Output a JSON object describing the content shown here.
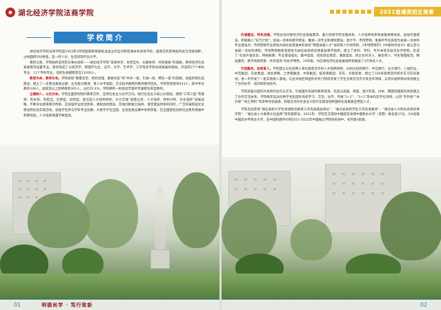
{
  "header": {
    "school_title": "湖北经济学院法商学院",
    "badge": "2021普通类招生简章"
  },
  "section": {
    "title": "学校简介"
  },
  "left_page": {
    "paragraphs": [
      {
        "highlight": "",
        "text": "湖北经济学院法商学院是2003年3月经国家教育部批准设立的全日制普通本科高等学校，座落在风景秀丽的武汉汤逊湖畔，占地面积500余亩，是一所人文、生态的现代化大学。"
      },
      {
        "highlight": "",
        "text": "建校以来，学院始终坚持走与事办高校——湖北经济学院“资源共享、优势互补、长期依存、共同发展”的道路，秉持经济社会发展需求设置专业。逐步形成了以经济学、管理学为主，法学、文学、艺术学、工学等多学科协调发展的格局。开设有27个本科专业、11个专科专业，在校生规模稳定在11000人。"
      },
      {
        "highlight": "教育为本，教师为本。",
        "text": "学院按照“数量充足、结构合理、素质优良”和“共享一批、引进一批、聘任一批”的思路，加强师资队伍建设，建立了一支政治素质过硬、业务能力精湛、育人水平高超、方法技术娴熟的教师教学团队。学校现有教师443人，其中专任教师338人，副高及以上职称教师301人，占比55.4%，学院拥有一批经验丰富的专兼职双师型教师。"
      },
      {
        "highlight": "立德树人，以生为本。",
        "text": "学院全面贯彻党的教育方针，坚持社会主义办学方向，践行社会主义核心价值观，围绕“三有三型”有理想、有本领、有担当、应用型、创新型、复合型人才培养目标，大力实施“质量立校、人才强校、特色兴校、文化强校”发展战略，不断深化教育教学改革，在加强专业综合改革、课程思政建设、实践创新能力培养、课堂建设改革的同时，广泛开展校园文化建设和社会实践活动，加强学生参与学科专业竞赛，大批学子在全国、全省各类竞赛中争获荣誉，在全国首批创新创业教育发展中积累经验，人才培养质量不断提高。"
      }
    ]
  },
  "right_page": {
    "paragraphs": [
      {
        "highlight": "内涵建设，特色发展。",
        "text": "学院主动对接经济社会发展需求，着力完善学院治理体系，人才培养体系和质量保障体系，加强内涵建设，积极融入“双万计划”，加强一流本科教学建设，推进一流专业和课程建设，会计学、市场营销、金融学专业获批为省级一流本科专业建设点；市场营销专业获批为湖北省普通本科高校“荆楚卓越人才”协同育人计划项目，《市场营销学》《中级财务会计》被认定为省级一流本科课程；市场营销教研室获批为湖北省高校优秀基层教学组织。建立了本科、专科、专升本等多层次办学结构，形成了“社会声誉优良、特色鲜明、专业建设强化、集中度高、招生就业稳定、满意度高、校企合作深入、联合育人、学生管理规范、精准服务、教学资源完善、共享度高”的办学特色，19年来，为区域经济社会发展培养和输送了3万余名人才。"
      },
      {
        "highlight": "开放融合，协同育人。",
        "text": "学院建立与社会用人单位紧密合作的人才培养机制，分别与招商银行、中信银行、光大银行、人福药业、中百集团、东星集团、湖北神鹰、土老帽集团、中商集团、拓尼奇集团、京东、华南贸易，建立了100多家稳定的校外实习实训基地，进一步开发了一批实践育人基地。与台湾地区和国外的专门院校开展了学生交换交流学习等合作项目，与贵州省黔南州等地建立了合作办学、培训等校地合作。"
      },
      {
        "highlight": "",
        "text": "学院加强与国内外高校的合作与交流，引进国外先进的教育资源，先后与美国、英国、澳大利亚、日本、韩国等国家的高校建立了合作交流关系，学院每年选派优秀学生赴国外高校学习、交流、访学，开展“2+2”、“3+1”等本科双学位项目，以及“专升硕”“本升硕”“硕士预科”等多种深造通道，积极主动为社会主义现代化建设培养国际化高素质应用型人才。"
      },
      {
        "highlight": "",
        "text": "学院先后获得“湖北高校大学生思想政治教育工作先进基层单位”、“湖北省高校学生工作先进集体”、“湖北省十大民办高校优秀学院”、“湖北省十大教育文化品牌”等荣誉称号。2021年，学院在艾瑞深中国校友会网中国民办大学（非营）排名第37位，为4星级中国高水平民办大学，在中国科教评价网2021-2022年中国独立学院排名榜中，名列第4星级。"
      }
    ]
  },
  "footer": {
    "left_page_number": "01",
    "right_page_number": "02",
    "slogan": "明德尚学 · 笃行致新"
  },
  "colors": {
    "accent_blue": "#2a7fc4",
    "brand_red": "#8a1c1f",
    "highlight_red": "#c8161d",
    "badge_gold": "#e8b62a"
  }
}
